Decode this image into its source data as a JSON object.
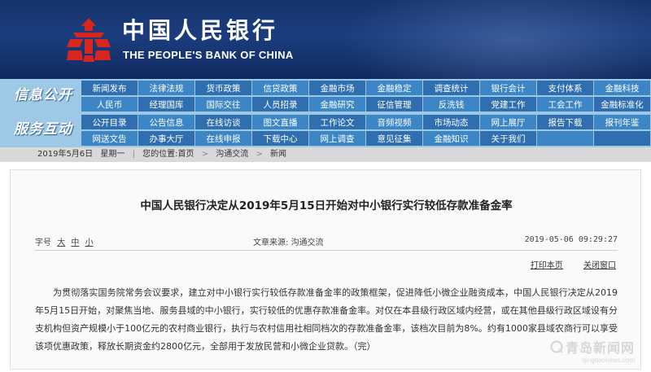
{
  "header": {
    "cn_name": "中国人民银行",
    "en_name": "THE PEOPLE'S BANK OF CHINA"
  },
  "nav": {
    "group1_label": "信息公开",
    "group2_label": "服务互动",
    "group1_items": [
      "新闻发布",
      "法律法规",
      "货币政策",
      "信贷政策",
      "金融市场",
      "金融稳定",
      "调查统计",
      "银行会计",
      "支付体系",
      "金融科技",
      "人民币",
      "经理国库",
      "国际交往",
      "人员招录",
      "金融研究",
      "征信管理",
      "反洗钱",
      "党建工作",
      "工会工作",
      "金融标准化"
    ],
    "group2_items": [
      "公开目录",
      "公告信息",
      "在线访谈",
      "图文直播",
      "工作论文",
      "音频视频",
      "市场动态",
      "网上展厅",
      "报告下载",
      "报刊年鉴",
      "网送文告",
      "办事大厅",
      "在线申报",
      "下载中心",
      "网上调查",
      "意见征集",
      "金融知识",
      "关于我们",
      "",
      ""
    ]
  },
  "breadcrumb": {
    "date": "2019年5月6日",
    "weekday": "星期一",
    "path_label": "您的位置:",
    "home": "首页",
    "section": "沟通交流",
    "current": "新闻"
  },
  "article": {
    "title": "中国人民银行决定从2019年5月15日开始对中小银行实行较低存款准备金率",
    "font_size_label": "字号",
    "font_sizes": [
      "大",
      "中",
      "小"
    ],
    "source_label": "文章来源:",
    "source": "沟通交流",
    "datetime": "2019-05-06 09:29:27",
    "print_label": "打印本页",
    "close_label": "关闭窗口",
    "body": "为贯彻落实国务院常务会议要求，建立对中小银行实行较低存款准备金率的政策框架，促进降低小微企业融资成本，中国人民银行决定从2019年5月15日开始，对聚焦当地、服务县域的中小银行，实行较低的优惠存款准备金率。对仅在本县级行政区域内经营，或在其他县级行政区域设有分支机构但资产规模小于100亿元的农村商业银行，执行与农村信用社相同档次的存款准备金率，该档次目前为8%。约有1000家县域农商行可以享受该项优惠政策，释放长期资金约2800亿元，全部用于发放民营和小微企业贷款。（完）"
  },
  "watermark": {
    "main": "青岛新闻网",
    "sub": "qingdaonews.com"
  },
  "colors": {
    "banner": "#1b3d7e",
    "logo_red": "#d7261e",
    "nav_dark": "#2f6fb0",
    "nav_light": "#3d86c6",
    "nav_bg": "#9dc9e6"
  }
}
